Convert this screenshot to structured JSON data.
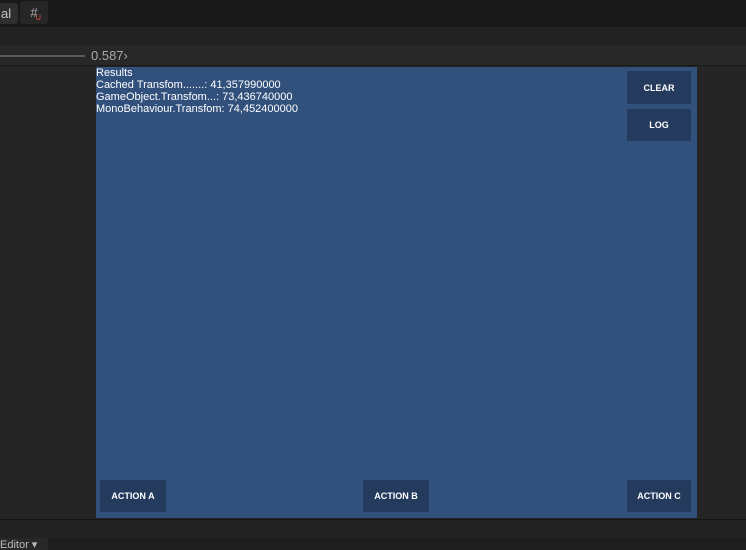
{
  "toolbar": {
    "tab_label": "al",
    "snap_icon": "grid-snap-icon"
  },
  "scale": {
    "value": "0.587›"
  },
  "results": {
    "title": "Results",
    "lines": [
      "Cached Transfom.......: 41,357990000",
      "GameObject.Transfom...: 73,436740000",
      "MonoBehaviour.Transfom: 74,452400000"
    ]
  },
  "buttons": {
    "clear": "CLEAR",
    "log": "LOG",
    "action_a": "ACTION A",
    "action_b": "ACTION B",
    "action_c": "ACTION C"
  },
  "bottom": {
    "editor_label": "Editor ▾"
  }
}
